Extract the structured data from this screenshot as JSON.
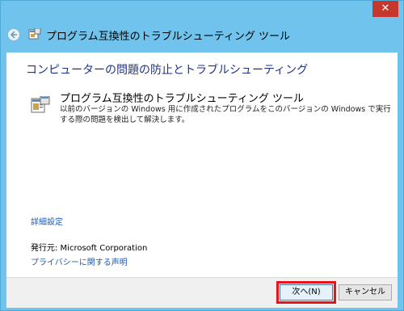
{
  "window": {
    "close_label": "✕",
    "title": "プログラム互換性のトラブルシューティング ツール"
  },
  "content": {
    "heading": "コンピューターの問題の防止とトラブルシューティング",
    "option": {
      "title": "プログラム互換性のトラブルシューティング ツール",
      "description": "以前のバージョンの Windows 用に作成されたプログラムをこのバージョンの Windows で実行する際の問題を検出して解決します。"
    },
    "advanced_link": "詳細設定",
    "publisher": "発行元:  Microsoft Corporation",
    "privacy_link": "プライバシーに関する声明"
  },
  "footer": {
    "next_label": "次へ(N)",
    "cancel_label": "キャンセル"
  },
  "colors": {
    "title_bar": "#6fc3ec",
    "close": "#c7382c",
    "heading": "#1e3287",
    "link": "#1a5bb5",
    "highlight": "#e8141c"
  }
}
